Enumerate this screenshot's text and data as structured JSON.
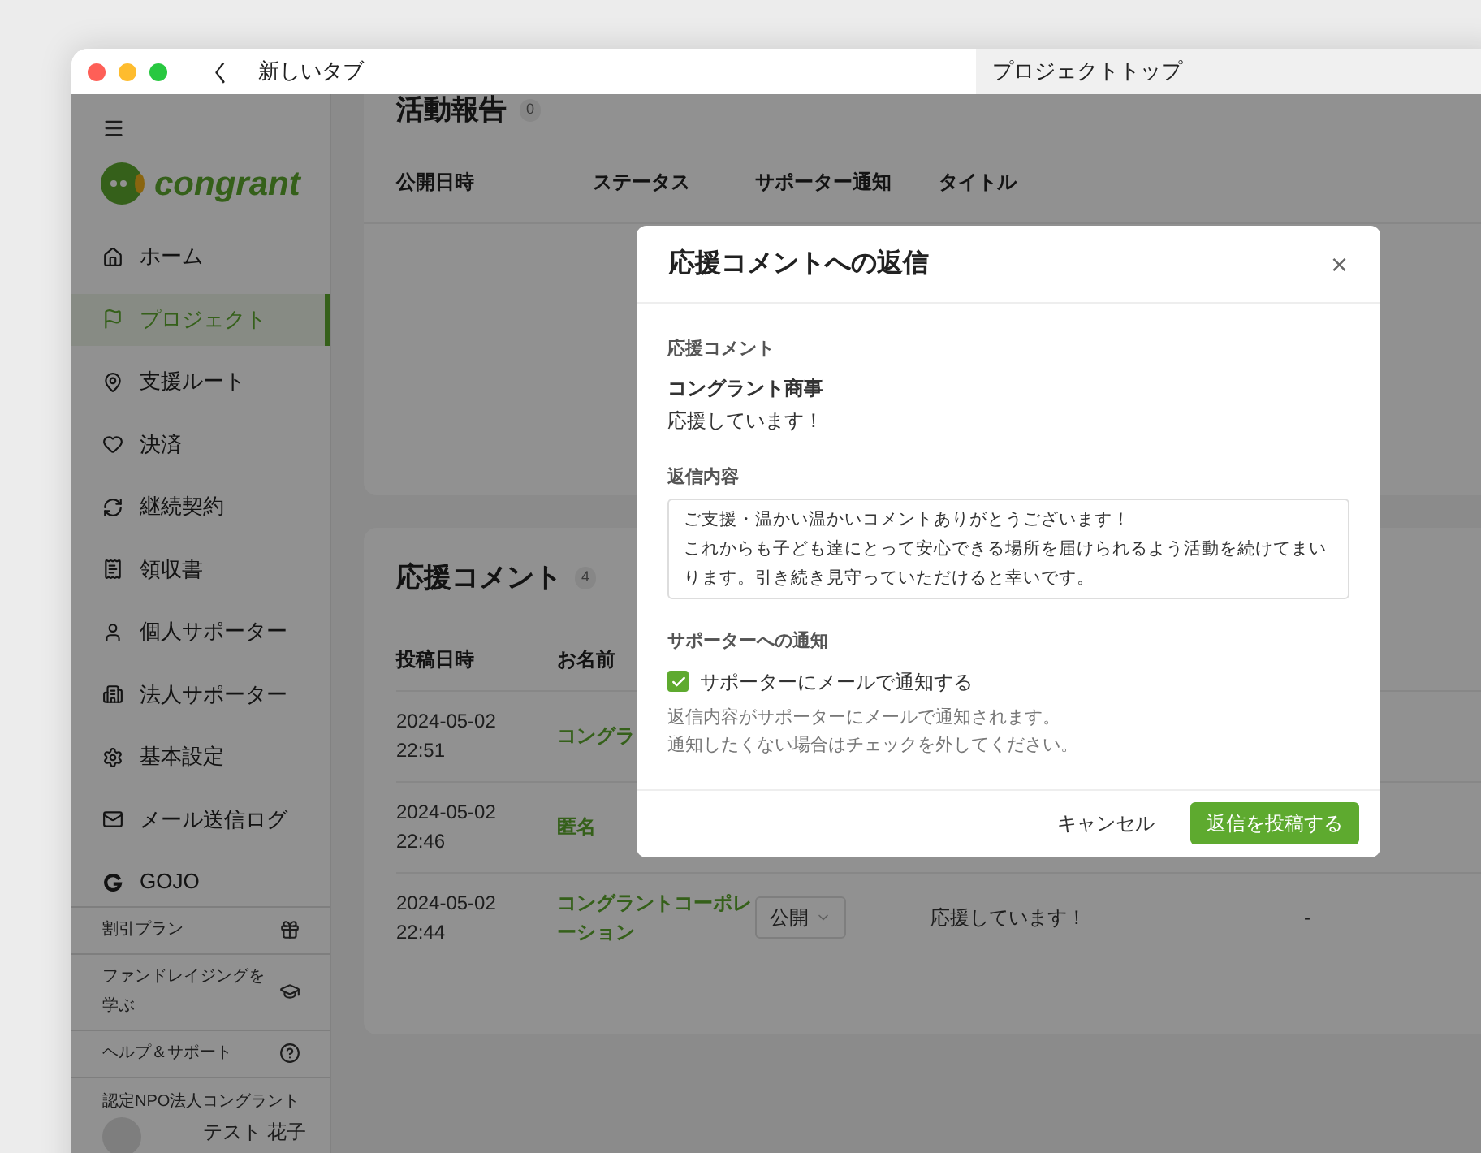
{
  "browser": {
    "back": "く",
    "tab_title": "新しいタブ",
    "address": "プロジェクトトップ"
  },
  "sidebar": {
    "logo": "congrant",
    "items": [
      {
        "label": "ホーム",
        "selected": false
      },
      {
        "label": "プロジェクト",
        "selected": true
      },
      {
        "label": "支援ルート",
        "selected": false
      },
      {
        "label": "決済",
        "selected": false
      },
      {
        "label": "継続契約",
        "selected": false
      },
      {
        "label": "領収書",
        "selected": false
      },
      {
        "label": "個人サポーター",
        "selected": false
      },
      {
        "label": "法人サポーター",
        "selected": false
      },
      {
        "label": "基本設定",
        "selected": false
      },
      {
        "label": "メール送信ログ",
        "selected": false
      },
      {
        "label": "GOJO",
        "selected": false
      }
    ],
    "links": [
      "割引プラン",
      "ファンドレイジングを学ぶ",
      "ヘルプ＆サポート"
    ],
    "org": "認定NPO法人コングラント",
    "user": "テスト 花子"
  },
  "reports": {
    "title": "活動報告",
    "count": "0",
    "columns": [
      "公開日時",
      "ステータス",
      "サポーター通知",
      "タイトル"
    ]
  },
  "comments": {
    "title": "応援コメント",
    "count": "4",
    "columns": [
      "投稿日時",
      "お名前"
    ],
    "rows": [
      {
        "posted": "2024-05-02 22:51",
        "name": "コングラ"
      },
      {
        "posted": "2024-05-02 22:46",
        "name": "匿名"
      },
      {
        "posted": "2024-05-02 22:44",
        "name": "コングラントコーポレーション",
        "status": "公開",
        "comment": "応援しています！",
        "column_5": "-"
      }
    ]
  },
  "modal": {
    "title": "応援コメントへの返信",
    "close": "×",
    "comment_label": "応援コメント",
    "comment_author": "コングラント商事",
    "comment_text": "応援しています！",
    "reply_label": "返信内容",
    "reply_lines": [
      "ご支援・温かい温かいコメントありがとうございます！",
      "これからも子ども達にとって安心できる場所を届けられるよう活動を続けてまいります。引き続き見守っていただけると幸いです。"
    ],
    "notify_label": "サポーターへの通知",
    "notify_checkbox": {
      "label": "サポーターにメールで通知する",
      "checked": true
    },
    "notify_help": [
      "返信内容がサポーターにメールで通知されます。",
      "通知したくない場合はチェックを外してください。"
    ],
    "cancel": "キャンセル",
    "submit": "返信を投稿する"
  }
}
